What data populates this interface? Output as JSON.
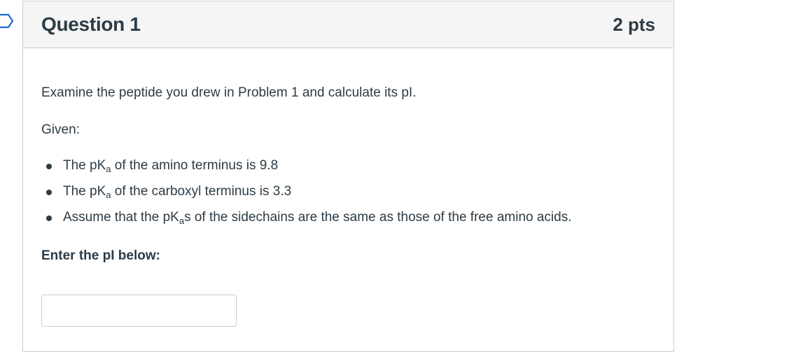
{
  "question": {
    "title": "Question 1",
    "points": "2 pts",
    "text": "Examine the peptide you drew in Problem 1 and calculate its pI.",
    "given_label": "Given:",
    "given_items": [
      {
        "before": "The pK",
        "sub": "a",
        "after": " of the amino terminus is 9.8"
      },
      {
        "before": "The pK",
        "sub": "a",
        "after": " of the carboxyl terminus is 3.3"
      },
      {
        "before": "Assume that the pK",
        "sub": "a",
        "after": "s of the sidechains are the same as those of the free amino acids."
      }
    ],
    "prompt": "Enter the pI below:",
    "answer_value": "",
    "answer_placeholder": ""
  },
  "colors": {
    "text": "#2d3b45",
    "header_bg": "#f5f5f5",
    "border": "#c7cdd1",
    "flag": "#1e6bd6"
  },
  "icons": {
    "flag": "bookmark-flag-icon"
  }
}
